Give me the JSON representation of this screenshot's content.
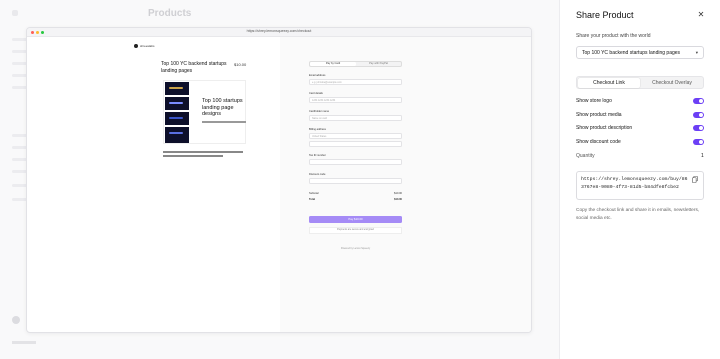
{
  "background": {
    "page_title": "Products"
  },
  "preview": {
    "url": "https://shrey.lemonsqueezy.com/checkout",
    "store_name": "shreeslabs",
    "product_title": "Top 100 YC backend startups landing pages",
    "price": "$10.00",
    "media_text": "Top 100 startups landing page designs",
    "pay_tabs": [
      "Pay by Card",
      "Pay with PayPal"
    ],
    "fields": [
      {
        "label": "Email address",
        "placeholder": "e.g. johndoe@example.com"
      },
      {
        "label": "Card details",
        "placeholder": "1234 1234 1234 1234"
      },
      {
        "label": "Cardholder name",
        "placeholder": "Name on card"
      },
      {
        "label": "Billing address",
        "placeholder": "United States"
      },
      {
        "label": "Tax ID number",
        "placeholder": ""
      },
      {
        "label": "Discount code",
        "placeholder": ""
      }
    ],
    "subtotal_label": "Subtotal",
    "subtotal_value": "$10.00",
    "total_label": "Total",
    "total_value": "$10.00",
    "pay_button": "Pay $10.00",
    "pay_note": "Payments are secure and encrypted",
    "powered_by": "Powered by Lemon Squeezy"
  },
  "panel": {
    "title": "Share Product",
    "close_icon": "close-icon",
    "subtitle": "Share your product with the world",
    "selected_product": "Top 100 YC backend startups landing pages",
    "tabs": [
      "Checkout Link",
      "Checkout Overlay"
    ],
    "active_tab": "Checkout Link",
    "options": [
      {
        "label": "Show store logo",
        "enabled": true
      },
      {
        "label": "Show product media",
        "enabled": true
      },
      {
        "label": "Show product description",
        "enabled": true
      },
      {
        "label": "Show discount code",
        "enabled": true
      }
    ],
    "quantity_label": "Quantity",
    "quantity_value": "1",
    "checkout_link": "https://shrey.lemonsqueezy.com/buy/863767e8-9080-4f73-81d5-b84dfe8fcbe2",
    "help_text": "Copy the checkout link and share it in emails, newsletters, social media etc.",
    "accent_color": "#6c3ff5"
  }
}
